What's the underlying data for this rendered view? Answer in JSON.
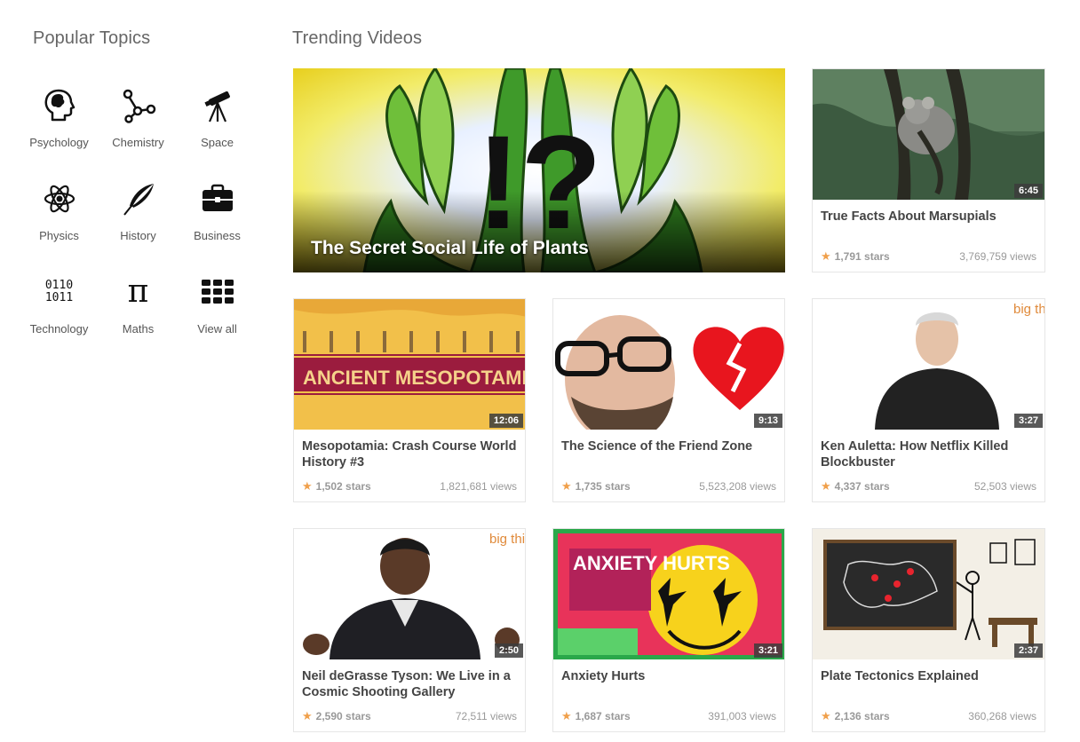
{
  "topics": {
    "title": "Popular Topics",
    "items": [
      {
        "label": "Psychology",
        "icon": "head-icon"
      },
      {
        "label": "Chemistry",
        "icon": "molecule-icon"
      },
      {
        "label": "Space",
        "icon": "telescope-icon"
      },
      {
        "label": "Physics",
        "icon": "atom-icon"
      },
      {
        "label": "History",
        "icon": "quill-icon"
      },
      {
        "label": "Business",
        "icon": "briefcase-icon"
      },
      {
        "label": "Technology",
        "icon": "binary-icon",
        "binary": [
          "0110",
          "1011"
        ]
      },
      {
        "label": "Maths",
        "icon": "pi-icon",
        "glyph": "π"
      },
      {
        "label": "View all",
        "icon": "grid-icon"
      }
    ]
  },
  "trending": {
    "title": "Trending Videos",
    "featured": {
      "title": "The Secret Social Life of Plants",
      "overlay": "!?"
    },
    "videos": [
      {
        "title": "True Facts About Marsupials",
        "duration": "6:45",
        "stars": "1,791 stars",
        "views": "3,769,759 views"
      },
      {
        "title": "Mesopotamia: Crash Course World History #3",
        "duration": "12:06",
        "stars": "1,502 stars",
        "views": "1,821,681 views",
        "thumb_text": "ANCIENT MESOPOTAMIA"
      },
      {
        "title": "The Science of the Friend Zone",
        "duration": "9:13",
        "stars": "1,735 stars",
        "views": "5,523,208 views"
      },
      {
        "title": "Ken Auletta: How Netflix Killed Blockbuster",
        "duration": "3:27",
        "stars": "4,337 stars",
        "views": "52,503 views",
        "thumb_text": "big think"
      },
      {
        "title": "Neil deGrasse Tyson: We Live in a Cosmic Shooting Gallery",
        "duration": "2:50",
        "stars": "2,590 stars",
        "views": "72,511 views",
        "thumb_text": "big think"
      },
      {
        "title": "Anxiety Hurts",
        "duration": "3:21",
        "stars": "1,687 stars",
        "views": "391,003 views",
        "thumb_text": "ANXIETY HURTS"
      },
      {
        "title": "Plate Tectonics Explained",
        "duration": "2:37",
        "stars": "2,136 stars",
        "views": "360,268 views"
      }
    ]
  },
  "colors": {
    "star": "#f0a04b",
    "duration_bg": "#3c3c3c",
    "text": "#444444",
    "muted": "#999999"
  }
}
